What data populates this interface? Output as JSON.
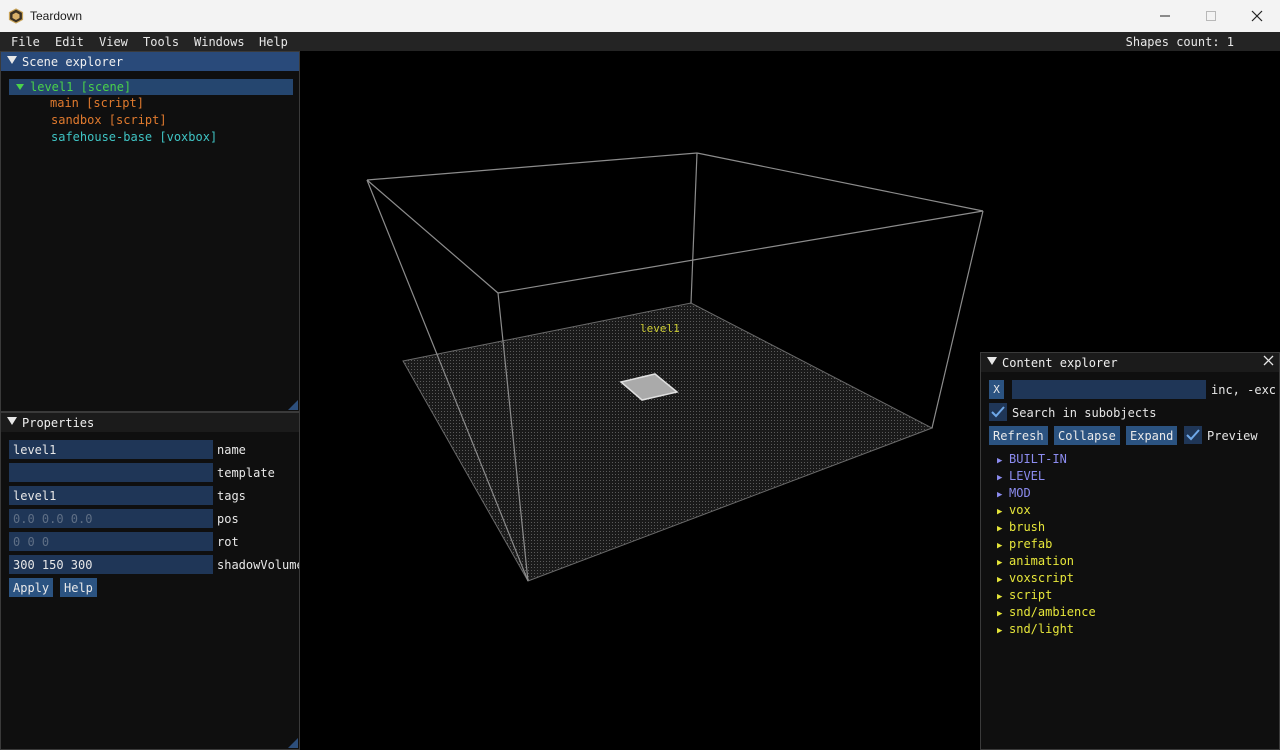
{
  "window": {
    "title": "Teardown"
  },
  "menu": {
    "items": [
      "File",
      "Edit",
      "View",
      "Tools",
      "Windows",
      "Help"
    ],
    "shapes_count": "Shapes count: 1"
  },
  "scene_explorer": {
    "title": "Scene explorer",
    "items": [
      {
        "label": "level1 [scene]",
        "color": "#4ad24a"
      },
      {
        "label": "main [script]",
        "color": "#e07a2e"
      },
      {
        "label": "sandbox [script]",
        "color": "#e07a2e"
      },
      {
        "label": "safehouse-base [voxbox]",
        "color": "#3fc4c4"
      }
    ]
  },
  "properties": {
    "title": "Properties",
    "fields": [
      {
        "value": "level1",
        "label": "name",
        "placeholder": false
      },
      {
        "value": "",
        "label": "template",
        "placeholder": false
      },
      {
        "value": "level1",
        "label": "tags",
        "placeholder": false
      },
      {
        "value": "0.0 0.0 0.0",
        "label": "pos",
        "placeholder": true
      },
      {
        "value": "0 0 0",
        "label": "rot",
        "placeholder": true
      },
      {
        "value": "300 150 300",
        "label": "shadowVolume",
        "placeholder": false
      }
    ],
    "apply_label": "Apply",
    "help_label": "Help"
  },
  "viewport": {
    "scene_label": "level1",
    "label_color": "#cccc33"
  },
  "content_explorer": {
    "title": "Content explorer",
    "clear_label": "X",
    "search_value": "",
    "search_hint": "inc, -exc",
    "search_subobjects_label": "Search in subobjects",
    "refresh_label": "Refresh",
    "collapse_label": "Collapse",
    "expand_label": "Expand",
    "preview_label": "Preview",
    "items": [
      {
        "label": "BUILT-IN",
        "color": "#8c8cf0"
      },
      {
        "label": "LEVEL",
        "color": "#8c8cf0"
      },
      {
        "label": "MOD",
        "color": "#8c8cf0"
      },
      {
        "label": "vox",
        "color": "#e6e63a"
      },
      {
        "label": "brush",
        "color": "#e6e63a"
      },
      {
        "label": "prefab",
        "color": "#e6e63a"
      },
      {
        "label": "animation",
        "color": "#e6e63a"
      },
      {
        "label": "voxscript",
        "color": "#e6e63a"
      },
      {
        "label": "script",
        "color": "#e6e63a"
      },
      {
        "label": "snd/ambience",
        "color": "#e6e63a"
      },
      {
        "label": "snd/light",
        "color": "#e6e63a"
      }
    ]
  },
  "colors": {
    "accent": "#294a7a",
    "input_bg": "#1f3657",
    "button_bg": "#2b5381"
  }
}
